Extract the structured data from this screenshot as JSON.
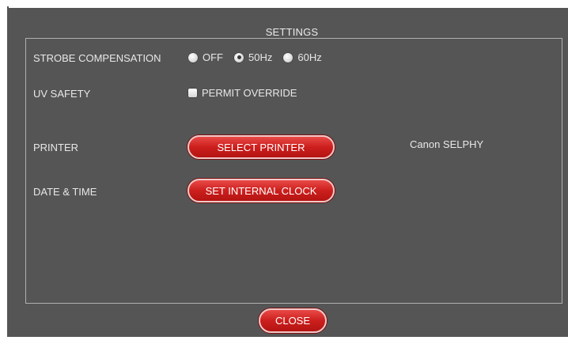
{
  "dialog": {
    "title": "SETTINGS",
    "close_label": "CLOSE"
  },
  "strobe": {
    "label": "STROBE COMPENSATION",
    "options": [
      {
        "label": "OFF",
        "checked": false
      },
      {
        "label": "50Hz",
        "checked": true
      },
      {
        "label": "60Hz",
        "checked": false
      }
    ]
  },
  "uv_safety": {
    "label": "UV SAFETY",
    "checkbox_label": "PERMIT OVERRIDE",
    "checked": false
  },
  "printer": {
    "label": "PRINTER",
    "button_label": "SELECT PRINTER",
    "selected": "Canon SELPHY"
  },
  "datetime": {
    "label": "DATE & TIME",
    "button_label": "SET INTERNAL CLOCK"
  },
  "colors": {
    "background": "#555555",
    "accent": "#cc1f1d"
  }
}
